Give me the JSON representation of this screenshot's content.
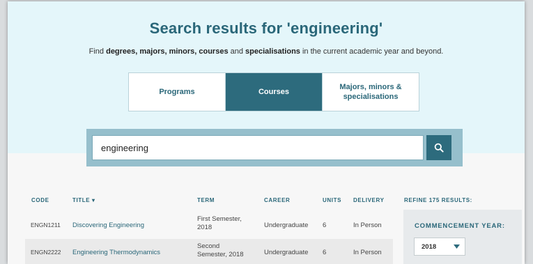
{
  "header": {
    "title": "Search results for 'engineering'",
    "subtitle": {
      "p1": "Find ",
      "b1": "degrees, majors, minors, courses",
      "p2": " and ",
      "b2": "specialisations",
      "p3": " in the current academic year and beyond."
    }
  },
  "tabs": [
    {
      "label": "Programs",
      "active": false
    },
    {
      "label": "Courses",
      "active": true
    },
    {
      "label": "Majors, minors & specialisations",
      "active": false
    }
  ],
  "search": {
    "value": "engineering",
    "placeholder": "",
    "icon": "search-icon"
  },
  "table": {
    "columns": {
      "code": "CODE",
      "title": "TITLE",
      "sort_indicator": "▾",
      "term": "TERM",
      "career": "CAREER",
      "units": "UNITS",
      "delivery": "DELIVERY"
    },
    "rows": [
      {
        "code": "ENGN1211",
        "title": "Discovering Engineering",
        "term_line1": "First Semester,",
        "term_line2": "2018",
        "career": "Undergraduate",
        "units": "6",
        "delivery": "In Person"
      },
      {
        "code": "ENGN2222",
        "title": "Engineering Thermodynamics",
        "term_line1": "Second",
        "term_line2": "Semester, 2018",
        "career": "Undergraduate",
        "units": "6",
        "delivery": "In Person"
      }
    ]
  },
  "refine": {
    "heading": "REFINE 175 RESULTS:",
    "commencement_label": "COMMENCEMENT YEAR:",
    "year_selected": "2018"
  },
  "colors": {
    "brand": "#2d6b7d",
    "hero_bg": "#e4f6fa",
    "search_frame": "#96bfcc"
  }
}
